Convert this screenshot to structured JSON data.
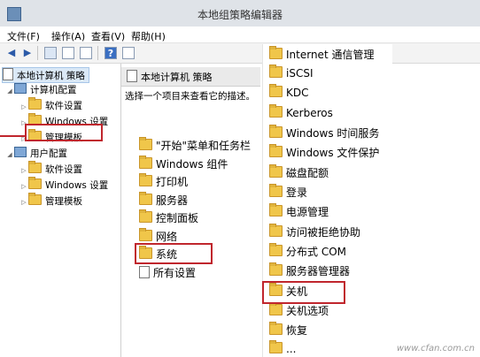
{
  "window": {
    "title": "本地组策略编辑器"
  },
  "menu": [
    "文件(F)",
    "操作(A)",
    "查看(V)",
    "帮助(H)"
  ],
  "tree": {
    "root": "本地计算机 策略",
    "computer_config": "计算机配置",
    "computer_children": [
      "软件设置",
      "Windows 设置",
      "管理模板"
    ],
    "user_config": "用户配置",
    "user_children": [
      "软件设置",
      "Windows 设置",
      "管理模板"
    ]
  },
  "middle": {
    "header": "本地计算机 策略",
    "hint": "选择一个项目来查看它的描述。",
    "items": [
      "\"开始\"菜单和任务栏",
      "Windows 组件",
      "打印机",
      "服务器",
      "控制面板",
      "网络",
      "系统",
      "所有设置"
    ]
  },
  "right": {
    "items": [
      "Internet 通信管理",
      "iSCSI",
      "KDC",
      "Kerberos",
      "Windows 时间服务",
      "Windows 文件保护",
      "磁盘配额",
      "登录",
      "电源管理",
      "访问被拒绝协助",
      "分布式 COM",
      "服务器管理器",
      "关机",
      "关机选项",
      "恢复",
      "..."
    ]
  },
  "watermark": "www.cfan.com.cn"
}
